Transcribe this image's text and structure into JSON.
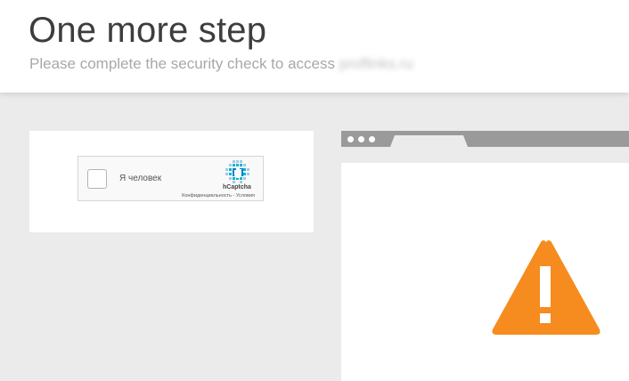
{
  "header": {
    "title": "One more step",
    "subtitle_prefix": "Please complete the security check to access",
    "domain": "proflinks.ru"
  },
  "captcha": {
    "checkbox_label": "Я человек",
    "brand": "hCaptcha",
    "privacy_link": "Конфиденциальность",
    "separator": " - ",
    "terms_link": "Условия",
    "checked": false
  },
  "illustration": {
    "icon": "warning-icon",
    "accent_color": "#f68b1f"
  }
}
